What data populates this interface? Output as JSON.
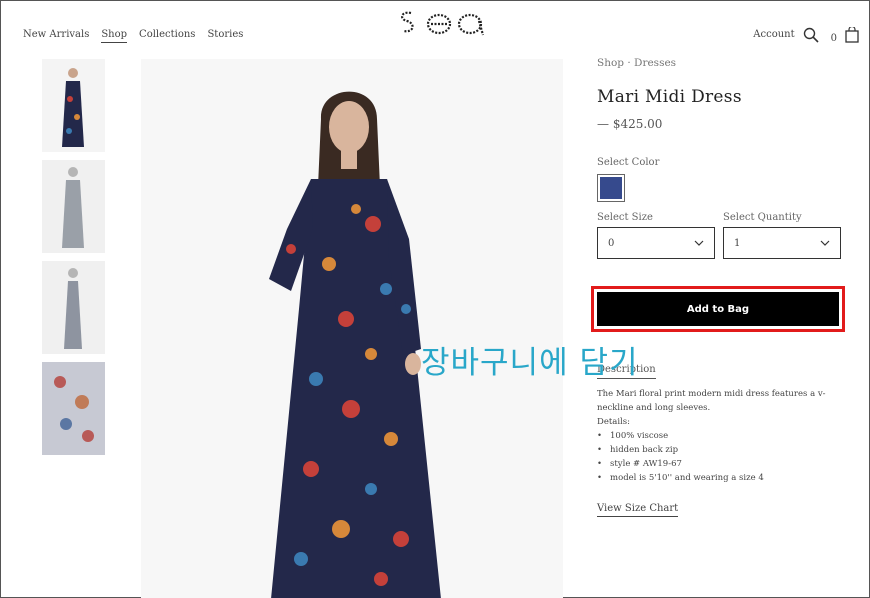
{
  "nav": {
    "items": [
      "New Arrivals",
      "Shop",
      "Collections",
      "Stories"
    ],
    "active": "Shop"
  },
  "header": {
    "logo_text": "Sea",
    "account_label": "Account",
    "bag_count": "0"
  },
  "breadcrumb": {
    "shop": "Shop",
    "sep": "·",
    "dresses": "Dresses"
  },
  "product": {
    "title": "Mari Midi Dress",
    "price": "— $425.00",
    "color_label": "Select Color",
    "color_hex": "#364a8d",
    "size_label": "Select Size",
    "size_value": "0",
    "qty_label": "Select Quantity",
    "qty_value": "1",
    "add_to_bag": "Add to Bag"
  },
  "description": {
    "label": "Description",
    "text": "The Mari floral print modern midi dress features a v-neckline and long sleeves.",
    "details_label": "Details:",
    "details": [
      "100% viscose",
      "hidden back zip",
      "style # AW19-67",
      "model is 5'10'' and wearing a size 4"
    ],
    "size_chart": "View Size Chart"
  },
  "overlay": {
    "caption": "장바구니에 담기",
    "highlight_color": "#e21b1b"
  }
}
